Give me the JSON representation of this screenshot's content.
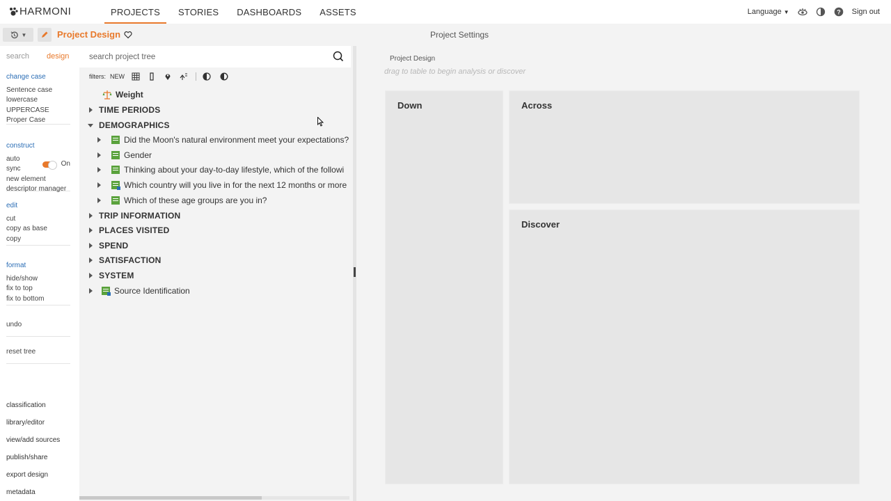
{
  "brand": {
    "name": "HARMONI"
  },
  "nav": {
    "tabs": [
      "PROJECTS",
      "STORIES",
      "DASHBOARDS",
      "ASSETS"
    ],
    "active": "PROJECTS"
  },
  "topright": {
    "language": "Language",
    "signout": "Sign out"
  },
  "subbar": {
    "project_title": "Project Design",
    "settings_title": "Project Settings"
  },
  "left": {
    "tabs": {
      "search": "search",
      "design": "design"
    },
    "change_case": {
      "head": "change case",
      "items": [
        "Sentence case",
        "lowercase",
        "UPPERCASE",
        "Proper Case"
      ]
    },
    "construct": {
      "head": "construct",
      "auto_sync": "auto sync",
      "auto_sync_state": "On",
      "items": [
        "new element",
        "descriptor manager"
      ]
    },
    "edit": {
      "head": "edit",
      "items": [
        "cut",
        "copy as base",
        "copy"
      ]
    },
    "format": {
      "head": "format",
      "items": [
        "hide/show",
        "fix to top",
        "fix to bottom"
      ]
    },
    "undo": "undo",
    "reset": "reset tree",
    "bottom_links": [
      "classification",
      "library/editor",
      "view/add sources",
      "publish/share",
      "export design",
      "metadata"
    ]
  },
  "tree": {
    "search_placeholder": "search project tree",
    "filters_label": "filters:",
    "filters_new": "NEW",
    "weight": "Weight",
    "categories": [
      "TIME PERIODS",
      "DEMOGRAPHICS"
    ],
    "demographics_children": [
      "Did the Moon's natural environment meet your expectations?",
      "Gender",
      "Thinking about your day-to-day lifestyle, which of the followi",
      "Which country will you live in for the next 12 months or more",
      "Which of these age groups are you in?"
    ],
    "more_categories": [
      "TRIP INFORMATION",
      "PLACES VISITED",
      "SPEND",
      "SATISFACTION",
      "SYSTEM"
    ],
    "source": "Source Identification"
  },
  "main": {
    "label": "Project Design",
    "hint": "drag to table to begin analysis or discover",
    "down": "Down",
    "across": "Across",
    "discover": "Discover"
  },
  "colors": {
    "accent": "#e8792b",
    "link": "#2a6db5",
    "question_icon": "#5aa23c"
  }
}
